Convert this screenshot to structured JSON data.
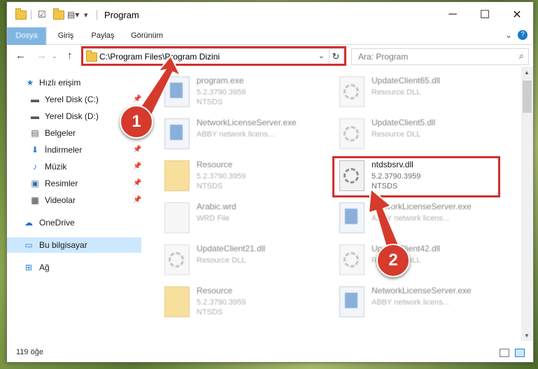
{
  "window": {
    "title": "Program"
  },
  "title_controls": {
    "minimize": "─",
    "maximize": "☐",
    "close": "✕"
  },
  "ribbon": {
    "tabs": [
      "Dosya",
      "Giriş",
      "Paylaş",
      "Görünüm"
    ],
    "help": "?"
  },
  "nav": {
    "back": "←",
    "forward": "→",
    "up": "↑",
    "refresh": "↻"
  },
  "address": {
    "path": "C:\\Program Files\\Program Dizini"
  },
  "search": {
    "placeholder": "Ara: Program"
  },
  "sidebar": {
    "items": [
      {
        "label": "Hızlı erişim",
        "icon": "star-icon",
        "pinned": false
      },
      {
        "label": "Yerel Disk (C:)",
        "icon": "drive-icon",
        "pinned": true
      },
      {
        "label": "Yerel Disk (D:)",
        "icon": "drive-icon",
        "pinned": true
      },
      {
        "label": "Belgeler",
        "icon": "documents-icon",
        "pinned": true
      },
      {
        "label": "İndirmeler",
        "icon": "download-icon",
        "pinned": true
      },
      {
        "label": "Müzik",
        "icon": "music-icon",
        "pinned": true
      },
      {
        "label": "Resimler",
        "icon": "pictures-icon",
        "pinned": true
      },
      {
        "label": "Videolar",
        "icon": "videos-icon",
        "pinned": true
      },
      {
        "label": "OneDrive",
        "icon": "cloud-icon",
        "pinned": false
      },
      {
        "label": "Bu bilgisayar",
        "icon": "computer-icon",
        "pinned": false
      },
      {
        "label": "Ağ",
        "icon": "network-icon",
        "pinned": false
      }
    ]
  },
  "files": [
    {
      "name": "program.exe",
      "line1": "5.2.3790.3959",
      "line2": "NTSDS",
      "icon": "app-icon"
    },
    {
      "name": "UpdateClient65.dll",
      "line1": "Resource DLL",
      "line2": "",
      "icon": "dll-icon"
    },
    {
      "name": "NetworkLicenseServer.exe",
      "line1": "ABBY network licens...",
      "line2": "",
      "icon": "app-icon"
    },
    {
      "name": "UpdateClient5.dll",
      "line1": "Resource DLL",
      "line2": "",
      "icon": "dll-icon"
    },
    {
      "name": "Resource",
      "line1": "5.2.3790.3959",
      "line2": "NTSDS",
      "icon": "folder-icon"
    },
    {
      "name": "ntdsbsrv.dll",
      "line1": "5.2.3790.3959",
      "line2": "NTSDS",
      "icon": "dll-icon"
    },
    {
      "name": "Arabic.wrd",
      "line1": "WRD File",
      "line2": "",
      "icon": "document-icon"
    },
    {
      "name": "NetworkLicenseServer.exe",
      "line1": "ABBY network licens...",
      "line2": "",
      "icon": "app-icon"
    },
    {
      "name": "UpdateClient21.dll",
      "line1": "Resource DLL",
      "line2": "",
      "icon": "dll-icon"
    },
    {
      "name": "UpdateClient42.dll",
      "line1": "Resource DLL",
      "line2": "",
      "icon": "dll-icon"
    },
    {
      "name": "Resource",
      "line1": "5.2.3790.3959",
      "line2": "NTSDS",
      "icon": "folder-icon"
    },
    {
      "name": "NetworkLicenseServer.exe",
      "line1": "ABBY network licens...",
      "line2": "",
      "icon": "app-icon"
    }
  ],
  "status": {
    "count": "119 öğe"
  },
  "annotations": {
    "step1": "1",
    "step2": "2",
    "highlight_color": "#d32f2f"
  },
  "colors": {
    "accent": "#1979ca",
    "selection": "#cce8ff"
  }
}
